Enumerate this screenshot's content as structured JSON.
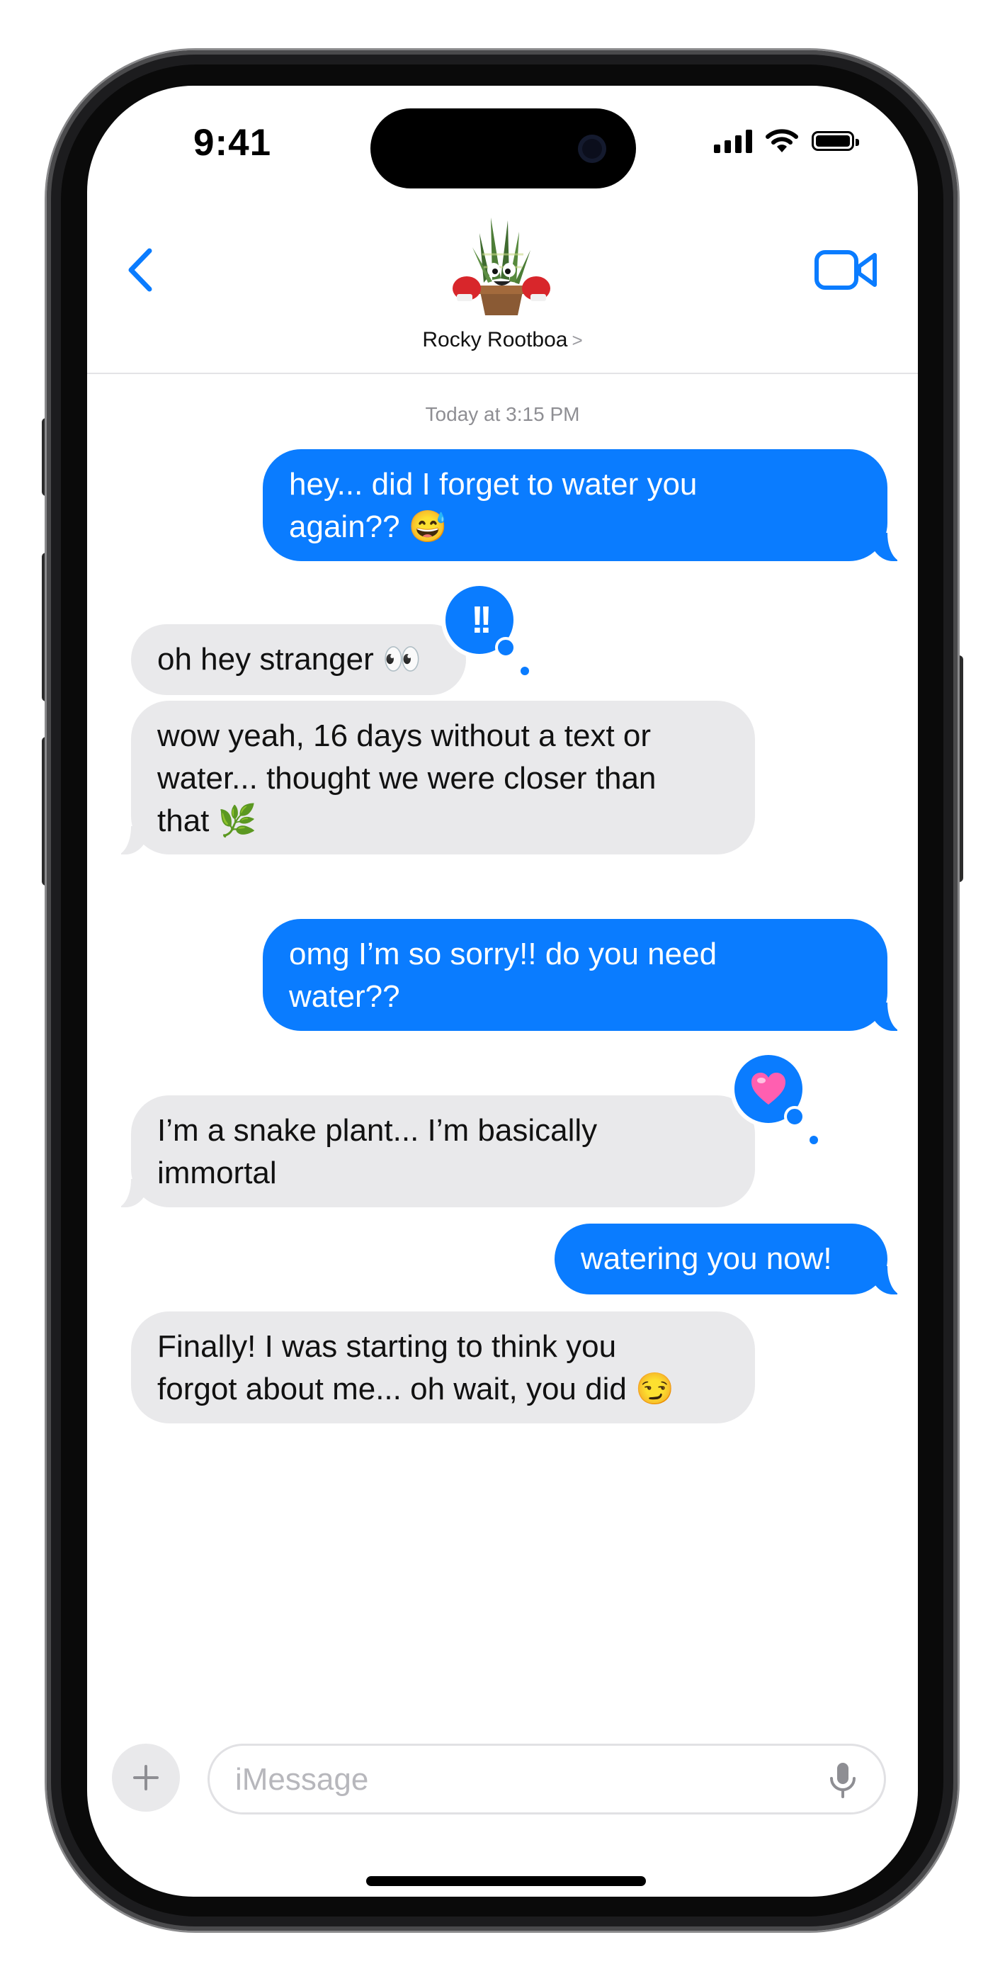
{
  "status_bar": {
    "time": "9:41"
  },
  "header": {
    "contact_name": "Rocky Rootboa",
    "chevron": ">"
  },
  "conversation": {
    "timestamp": "Today at 3:15 PM",
    "messages": [
      {
        "from": "me",
        "lines": [
          "hey... did I forget to water you",
          "again?? 😅"
        ]
      },
      {
        "from": "them",
        "lines": [
          "oh hey stranger 👀"
        ],
        "reaction": "!!"
      },
      {
        "from": "them",
        "lines": [
          "wow yeah, 16 days without a text or",
          "water... thought we were closer than",
          "that 🌿"
        ]
      },
      {
        "from": "me",
        "lines": [
          "omg I’m so sorry!! do you need",
          "water??"
        ]
      },
      {
        "from": "them",
        "lines": [
          "I’m a snake plant... I’m basically",
          "immortal"
        ],
        "reaction": "💗"
      },
      {
        "from": "me",
        "lines": [
          "watering you now!"
        ]
      },
      {
        "from": "them",
        "lines": [
          "Finally! I was starting to think you",
          "forgot about me... oh wait, you did 😏"
        ]
      }
    ]
  },
  "composer": {
    "placeholder": "iMessage",
    "value": "",
    "plus_icon": "plus-icon",
    "mic_icon": "microphone-icon"
  },
  "colors": {
    "sent_bubble": "#0a7cff",
    "received_bubble": "#e9e9eb",
    "accent": "#0a7cff"
  }
}
